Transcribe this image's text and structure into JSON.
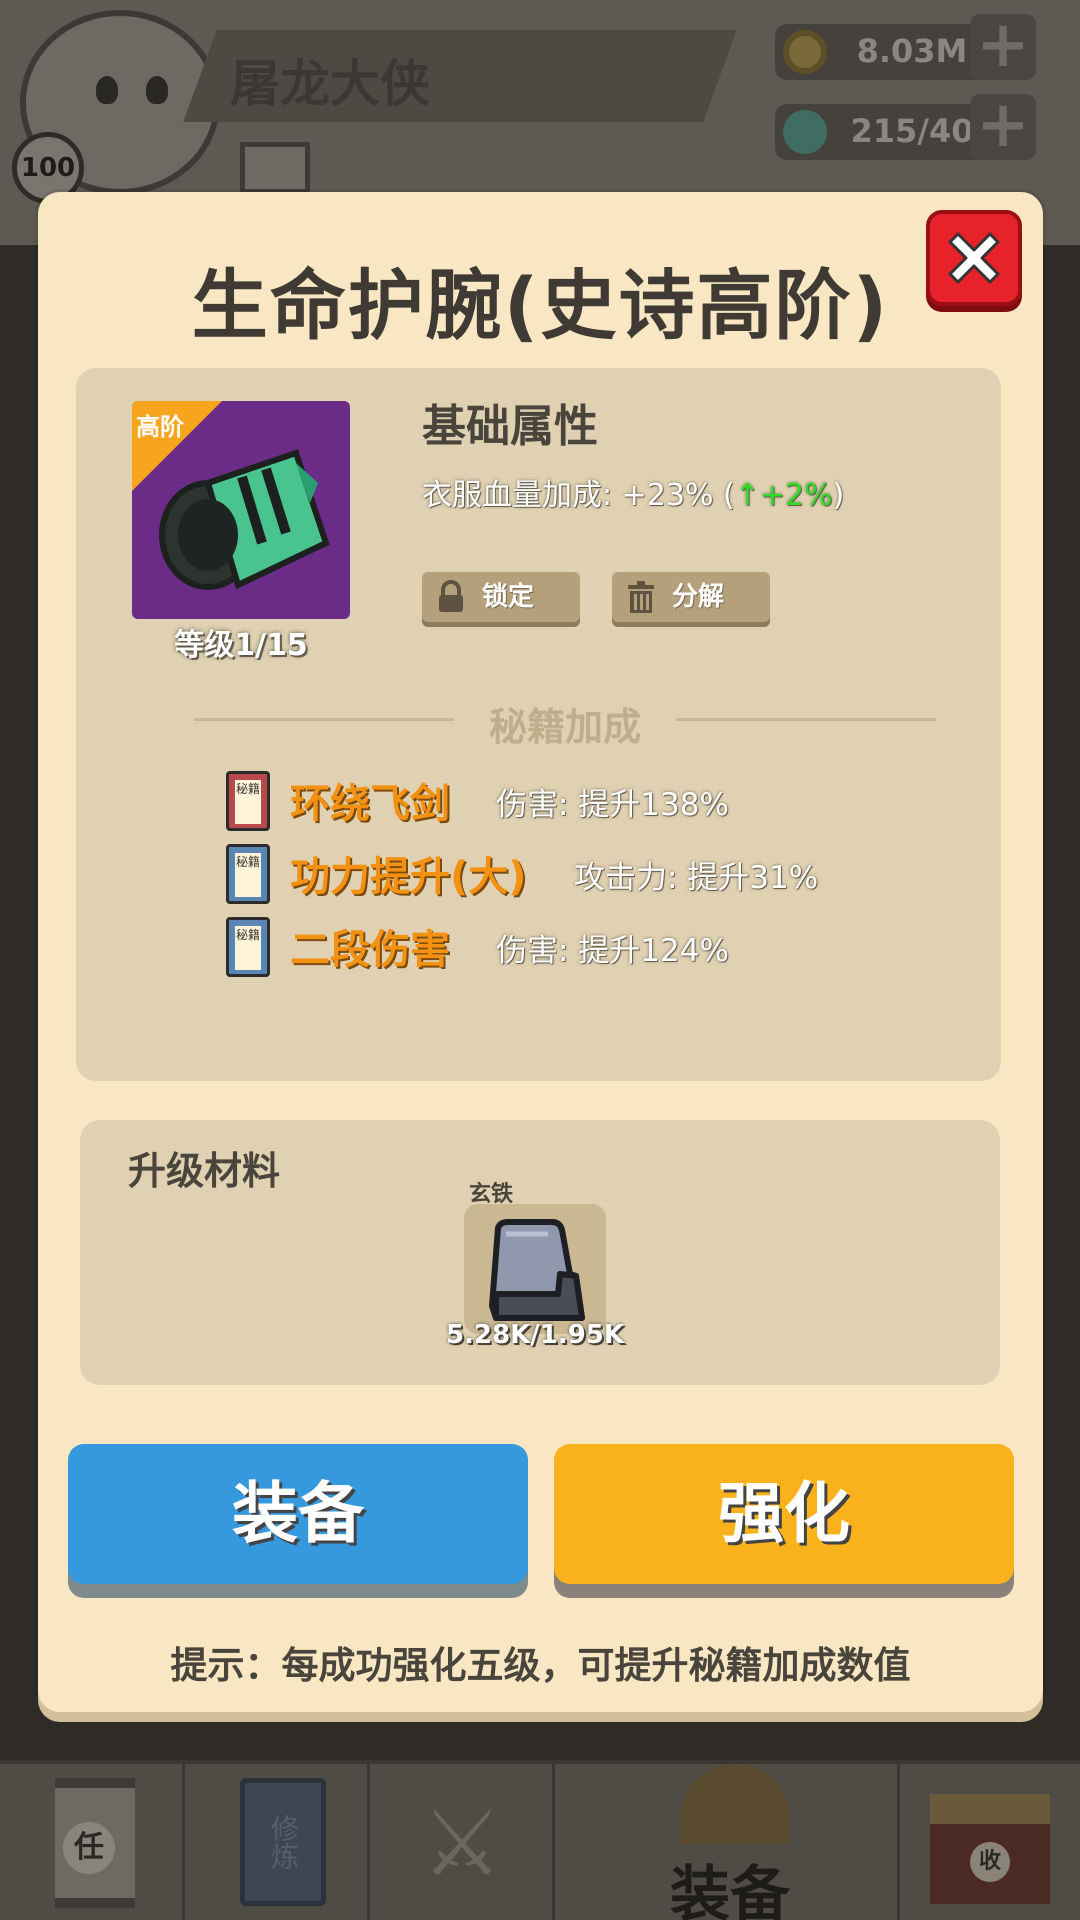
{
  "background": {
    "player_name": "屠龙大侠",
    "player_level": "100",
    "coins": "8.03M",
    "gems": "215/40",
    "nav": {
      "task_label": "任",
      "cultivate_label": "修炼",
      "equipment_label": "装备",
      "shop_label": "收"
    }
  },
  "modal": {
    "title": "生命护腕(史诗高阶)",
    "item": {
      "rank_badge": "高阶",
      "level": "等级1/15"
    },
    "base_attributes": {
      "heading": "基础属性",
      "stat_label": "衣服血量加成: +23% (",
      "stat_increase": "↑+2%",
      "stat_close": ")"
    },
    "buttons": {
      "lock": "锁定",
      "salvage": "分解",
      "equip": "装备",
      "upgrade": "强化"
    },
    "manual_bonus": {
      "heading": "秘籍加成",
      "book_glyph": "秘籍",
      "skills": [
        {
          "name": "环绕飞剑",
          "effect": "伤害: 提升138%",
          "book_color": "#b84a4a"
        },
        {
          "name": "功力提升(大)",
          "effect": "攻击力: 提升31%",
          "book_color": "#5b86b3"
        },
        {
          "name": "二段伤害",
          "effect": "伤害: 提升124%",
          "book_color": "#5b86b3"
        }
      ]
    },
    "materials": {
      "heading": "升级材料",
      "item_name": "玄铁",
      "count": "5.28K/1.95K"
    },
    "hint": "提示：每成功强化五级，可提升秘籍加成数值"
  },
  "colors": {
    "modal_bg": "#f8e7c2",
    "panel_bg": "#dfd1b1",
    "equip_button": "#3698dd",
    "upgrade_button": "#f9b21b",
    "skill_name": "#f29112",
    "close_button": "#e8222a",
    "item_background": "#6a2c87",
    "increase_green": "#2ede22"
  }
}
